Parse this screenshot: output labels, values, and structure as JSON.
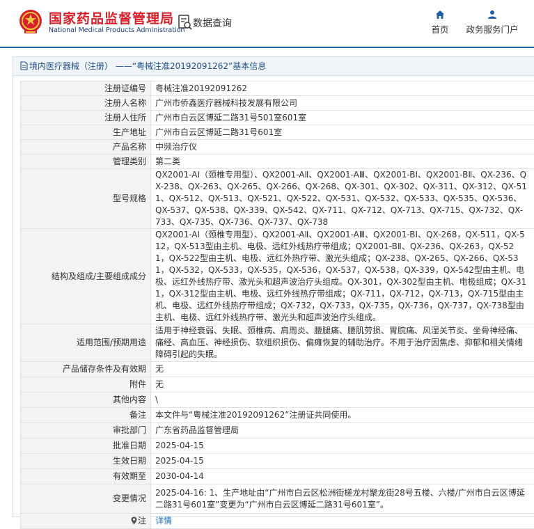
{
  "header": {
    "org_name_cn": "国家药品监督管理局",
    "org_name_en": "National Medical Products Administration",
    "query_label": "数据查询",
    "nav": [
      {
        "label": "首页",
        "icon": "home-icon"
      },
      {
        "label": "政务服务门户",
        "icon": "user-icon"
      }
    ],
    "accent_color": "#1e5fa8",
    "brand_color": "#d71f2a"
  },
  "panel": {
    "title": "境内医疗器械（注册） ——“粤械注准20192091262”基本信息"
  },
  "fields": [
    {
      "label": "注册证编号",
      "value": "粤械注准20192091262"
    },
    {
      "label": "注册人名称",
      "value": "广州市侨鑫医疗器械科技发展有限公司"
    },
    {
      "label": "注册人住所",
      "value": "广州市白云区博延二路31号501室601室"
    },
    {
      "label": "生产地址",
      "value": "广州市白云区博延二路31号601室"
    },
    {
      "label": "产品名称",
      "value": "中频治疗仪"
    },
    {
      "label": "管理类别",
      "value": "第二类"
    },
    {
      "label": "型号规格",
      "value": "QX2001-AI（颈椎专用型）、QX2001-AⅡ、QX2001-AⅢ、QX2001-BI、QX2001-BⅡ、QX-236、QX-238、QX-263、QX-265、QX-266、QX-268、QX-301、QX-302、QX-311、QX-312、QX-511、QX-512、QX-513、QX-521、QX-522、QX-531、QX-532、QX-533、QX-535、QX-536、QX-537、QX-538、QX-339、QX-542、QX-711、QX-712、QX-713、QX-715、QX-732、QX-733、QX-735、QX-736、QX-737、QX-738"
    },
    {
      "label": "结构及组成/主要组成成分",
      "value": "QX2001-AI（颈椎专用型）、QX2001-AⅡ、QX2001-AⅢ、QX2001-BI、QX-268，QX-511，QX-512，QX-513型由主机、电极、远红外线热疗带组成；QX2001-BⅡ、QX-236、QX-263，QX-521，QX-522型由主机、电极、远红外热疗带、激光头组成；QX-238、QX-265、QX-266、QX-531，QX-532，QX-533，QX-535，QX-536，QX-537，QX-538，QX-339，QX-542型由主机、电极、远红外线热疗带、激光头和超声波治疗头组成。QX-301，QX-302型由主机、电极组成；QX-311，QX-312型由主机、电极、远红外线热疗带组成；QX-711，QX-712，QX-713，QX-715型由主机、电极、远红外线热疗带组成；QX-732，QX-733，QX-735，QX-736，QX-737，QX-738型由主机、电极、远红外线热疗带、激光头和超声波治疗头组成。"
    },
    {
      "label": "适用范围/预期用途",
      "value": "适用于神经衰弱、失眠、颈椎病、肩周炎、腰腿痛、腰肌劳损、胃脘痛、风湿关节炎、坐骨神经痛、痛经、高血压、神经损伤、软组织损伤、偏瘫恢复的辅助治疗。不用于治疗因焦虑、抑郁和相关情绪障碍引起的失眠。"
    },
    {
      "label": "产品储存条件及有效期",
      "value": "无"
    },
    {
      "label": "附件",
      "value": "无"
    },
    {
      "label": "其他内容",
      "value": "\\"
    },
    {
      "label": "备注",
      "value": "本文件与“粤械注准20192091262”注册证共同使用。"
    },
    {
      "label": "审批部门",
      "value": "广东省药品监督管理局"
    },
    {
      "label": "批准日期",
      "value": "2025-04-15"
    },
    {
      "label": "生效日期",
      "value": "2025-04-15"
    },
    {
      "label": "有效期至",
      "value": "2030-04-14"
    },
    {
      "label": "变更情况",
      "value": "2025-04-16: 1、生产地址由“广州市白云区松洲街槎龙村聚龙街28号五楼、六楼/广州市白云区博延二路31号601室”变更为“广州市白云区博延二路31号601室”。"
    }
  ],
  "footer_row": {
    "label": "注",
    "icon": "location-pin-icon",
    "link": "详情"
  }
}
